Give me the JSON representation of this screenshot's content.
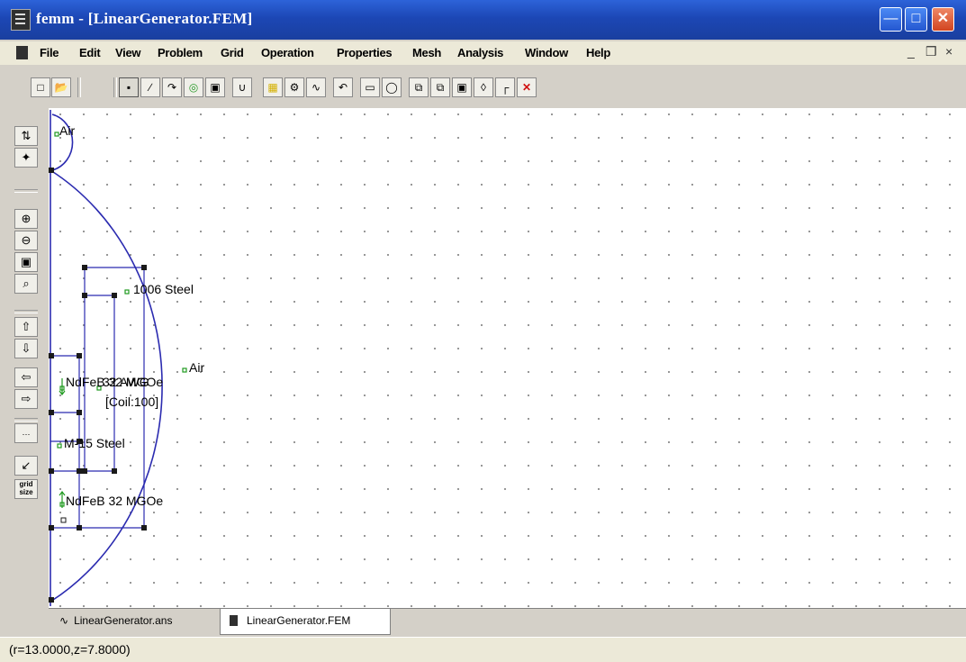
{
  "window": {
    "title": "femm - [LinearGenerator.FEM]"
  },
  "menu": [
    "File",
    "Edit",
    "View",
    "Problem",
    "Grid",
    "Operation",
    "Properties",
    "Mesh",
    "Analysis",
    "Window",
    "Help"
  ],
  "mdi_controls": [
    "_",
    "❒",
    "×"
  ],
  "toolbar_icons": [
    "new-file",
    "open-file",
    "point-mode",
    "segment-mode",
    "arc-mode",
    "block-label-mode",
    "group-mode",
    "zoom-natural",
    "show-mesh",
    "create-mesh",
    "analyze",
    "view-results",
    "undo",
    "window-select",
    "circle-select",
    "copy",
    "mirror",
    "scale",
    "move",
    "fillet",
    "delete"
  ],
  "side_toolbar_icons": [
    "show-grid",
    "snap-grid",
    "zoom-in",
    "zoom-out",
    "zoom-window",
    "zoom-natural",
    "pan-up",
    "pan-down",
    "pan-left",
    "pan-right",
    "grid-display",
    "snap-toggle",
    "grid-size"
  ],
  "labels": {
    "air_top": "Air",
    "steel_1006": "1006 Steel",
    "air_mid": "Air",
    "ndfeb_upper": "NdFeB 32 MGOe",
    "awg": "32 AWG",
    "coil": "[Coil:100]",
    "m15": "M-15 Steel",
    "ndfeb_lower": "NdFeB 32 MGOe"
  },
  "tabs": [
    "LinearGenerator.ans",
    "LinearGenerator.FEM"
  ],
  "active_tab": "LinearGenerator.FEM",
  "status": "(r=13.0000,z=7.8000)",
  "colors": {
    "titlebar": "#1c47b5",
    "boundary": "#2b2bb0",
    "node": "#1a1a1a",
    "label_marker": "#1f9a1f"
  }
}
